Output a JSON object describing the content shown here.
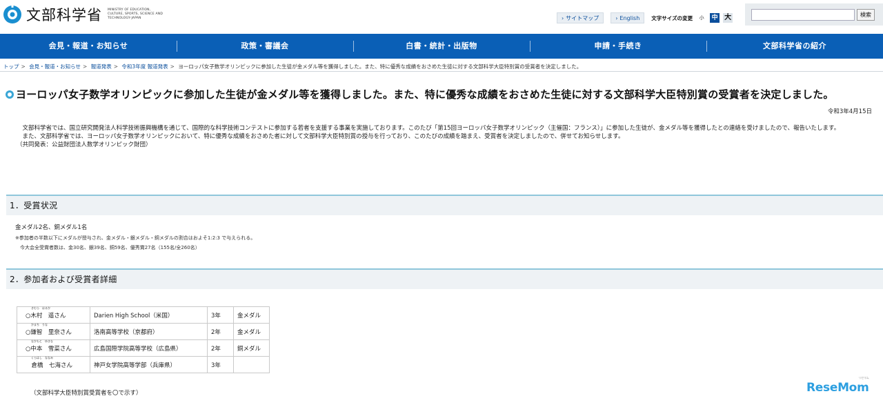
{
  "header": {
    "logo_text": "文部科学省",
    "logo_en": "MINISTRY OF EDUCATION, CULTURE, SPORTS, SCIENCE AND TECHNOLOGY-JAPAN",
    "sitemap_label": "サイトマップ",
    "english_label": "English",
    "font_size_label": "文字サイズの変更",
    "font_small": "小",
    "font_medium": "中",
    "font_large": "大",
    "search_button": "検索",
    "search_value": ""
  },
  "nav": {
    "items": [
      "会見・報道・お知らせ",
      "政策・審議会",
      "白書・統計・出版物",
      "申請・手続き",
      "文部科学省の紹介"
    ]
  },
  "breadcrumb": {
    "items": [
      "トップ",
      "会見・報道・お知らせ",
      "報道発表",
      "令和3年度 報道発表"
    ],
    "current": "ヨーロッパ女子数学オリンピックに参加した生徒が金メダル等を獲得しました。また、特に優秀な成績をおさめた生徒に対する文部科学大臣特別賞の受賞者を決定しました。"
  },
  "page": {
    "title": "ヨーロッパ女子数学オリンピックに参加した生徒が金メダル等を獲得しました。また、特に優秀な成績をおさめた生徒に対する文部科学大臣特別賞の受賞者を決定しました。",
    "date": "令和3年4月15日",
    "intro_1": "文部科学省では、国立研究開発法人科学技術振興機構を通じて、国際的な科学技術コンテストに参加する若者を支援する事業を実施しております。このたび「第15回ヨーロッパ女子数学オリンピック（主催国：フランス）」に参加した生徒が、金メダル等を獲得したとの連絡を受けましたので、報告いたします。",
    "intro_2": "また、文部科学省では、ヨーロッパ女子数学オリンピックにおいて、特に優秀な成績をおさめた者に対して文部科学大臣特別賞の授与を行っており、このたびの成績を踏まえ、受賞者を決定しましたので、併せてお知らせします。",
    "intro_3": "（共同発表：公益財団法人数学オリンピック財団）"
  },
  "section1": {
    "heading": "1．受賞状況",
    "summary": "金メダル2名、銅メダル1名",
    "note": "※参加者の半数以下にメダルが授与され、金メダル・銀メダル・銅メダルの割合はおよそ1:2:3 で与えられる。",
    "total": "今大会全受賞者数は、金30名、銀39名、銅59名、優秀賞27名（155名/全260名）"
  },
  "section2": {
    "heading": "2．参加者および受賞者詳細",
    "rows": [
      {
        "name": "○木村　遥さん",
        "ruby": "きむら　はるか",
        "school": "Darien High School（米国）",
        "grade": "3年",
        "medal": "金メダル"
      },
      {
        "name": "○鎌智　里奈さん",
        "ruby": "かまち　りな",
        "school": "洛南高等学校（京都府）",
        "grade": "2年",
        "medal": "金メダル"
      },
      {
        "name": "○中本　雪菜さん",
        "ruby": "なかもと　ゆきな",
        "school": "広島国際学院高等学校（広島県）",
        "grade": "2年",
        "medal": "銅メダル"
      },
      {
        "name": "　倉橋　七海さん",
        "ruby": "くらはし　ななみ",
        "school": "神戸女学院高等学部（兵庫県）",
        "grade": "3年",
        "medal": ""
      }
    ],
    "footnote": "（文部科学大臣特別賞受賞者を〇で示す）"
  },
  "watermark": {
    "text": "ReseMom",
    "ruby": "リセマム"
  },
  "colors": {
    "nav_bg": "#0a5fb6",
    "accent": "#3aa6d6",
    "link": "#0b4f9c"
  }
}
